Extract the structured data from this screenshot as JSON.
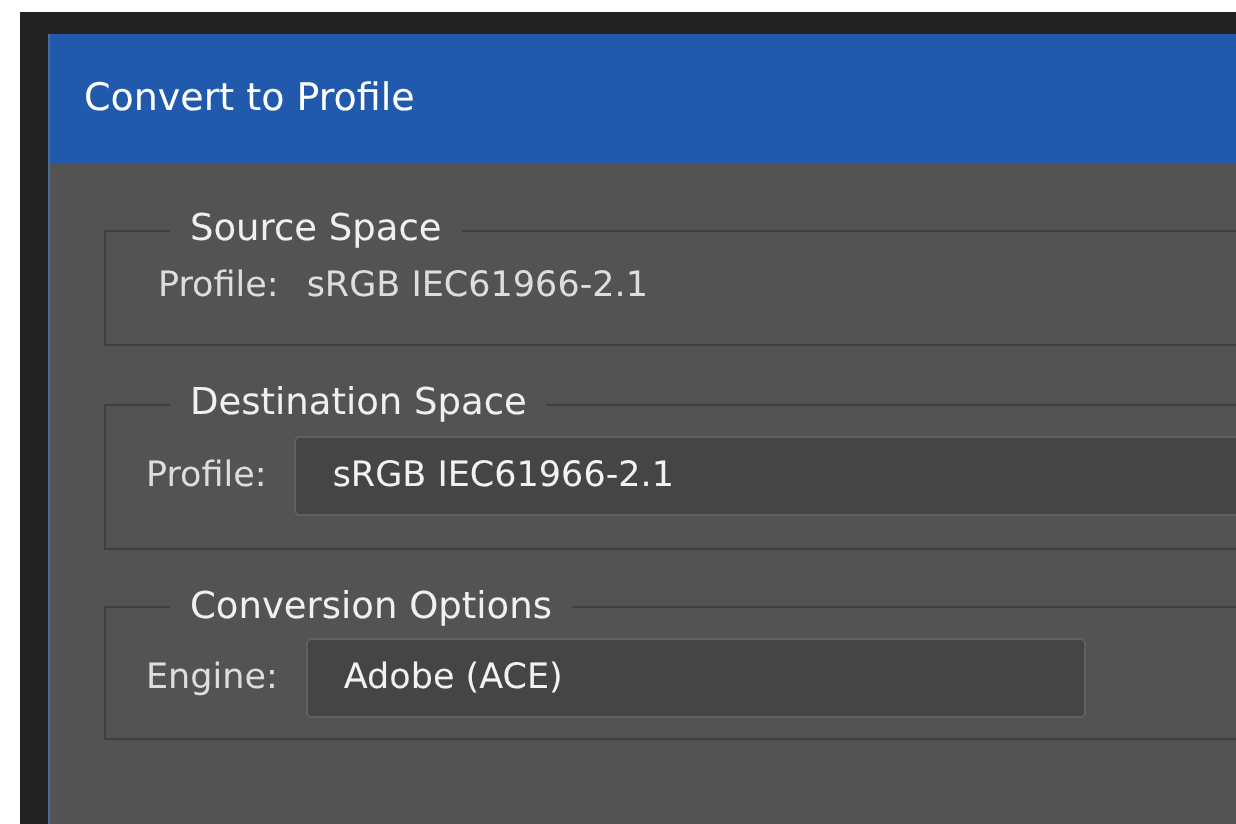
{
  "window": {
    "title": "Convert to Profile"
  },
  "source_space": {
    "legend": "Source Space",
    "profile_label": "Profile:",
    "profile": "sRGB IEC61966-2.1"
  },
  "destination_space": {
    "legend": "Destination Space",
    "profile_label": "Profile:",
    "profile": "sRGB IEC61966-2.1"
  },
  "conversion_options": {
    "legend": "Conversion Options",
    "engine_label": "Engine:",
    "engine": "Adobe (ACE)"
  }
}
